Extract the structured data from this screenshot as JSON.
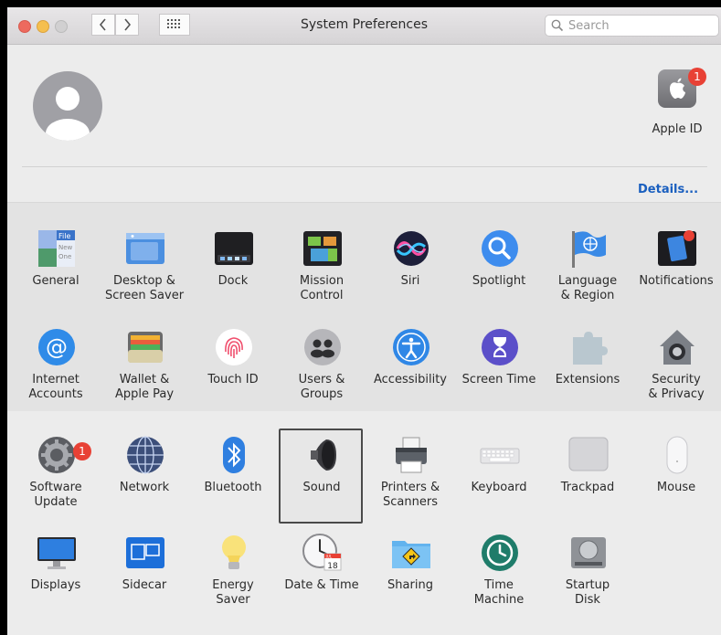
{
  "window": {
    "title": "System Preferences"
  },
  "search": {
    "placeholder": "Search"
  },
  "apple_id": {
    "label": "Apple ID",
    "badge": "1"
  },
  "details_link": "Details...",
  "panes": [
    [
      "General",
      "Desktop & Screen Saver",
      "Dock",
      "Mission Control",
      "Siri",
      "Spotlight",
      "Language & Region",
      "Notifications"
    ],
    [
      "Internet Accounts",
      "Wallet & Apple Pay",
      "Touch ID",
      "Users & Groups",
      "Accessibility",
      "Screen Time",
      "Extensions",
      "Security & Privacy"
    ],
    [
      "Software Update",
      "Network",
      "Bluetooth",
      "Sound",
      "Printers & Scanners",
      "Keyboard",
      "Trackpad",
      "Mouse"
    ],
    [
      "Displays",
      "Sidecar",
      "Energy Saver",
      "Date & Time",
      "Sharing",
      "Time Machine",
      "Startup Disk"
    ]
  ],
  "labels": {
    "general": "General",
    "desktop": [
      "Desktop &",
      "Screen Saver"
    ],
    "dock": "Dock",
    "mission": [
      "Mission",
      "Control"
    ],
    "siri": "Siri",
    "spotlight": "Spotlight",
    "language": [
      "Language",
      "& Region"
    ],
    "notifications": "Notifications",
    "internet": [
      "Internet",
      "Accounts"
    ],
    "wallet": [
      "Wallet &",
      "Apple Pay"
    ],
    "touchid": "Touch ID",
    "users": [
      "Users &",
      "Groups"
    ],
    "accessibility": "Accessibility",
    "screentime": "Screen Time",
    "extensions": "Extensions",
    "security": [
      "Security",
      "& Privacy"
    ],
    "software": [
      "Software",
      "Update"
    ],
    "network": "Network",
    "bluetooth": "Bluetooth",
    "sound": "Sound",
    "printers": [
      "Printers &",
      "Scanners"
    ],
    "keyboard": "Keyboard",
    "trackpad": "Trackpad",
    "mouse": "Mouse",
    "displays": "Displays",
    "sidecar": "Sidecar",
    "energy": [
      "Energy",
      "Saver"
    ],
    "datetime": "Date & Time",
    "sharing": "Sharing",
    "timemachine": [
      "Time",
      "Machine"
    ],
    "startup": [
      "Startup",
      "Disk"
    ]
  },
  "software_update_badge": "1",
  "calendar": {
    "month": "JUL",
    "day": "18"
  },
  "selected_pane": "Sound",
  "colors": {
    "accent": "#1a5fbf",
    "badge": "#e84135"
  }
}
